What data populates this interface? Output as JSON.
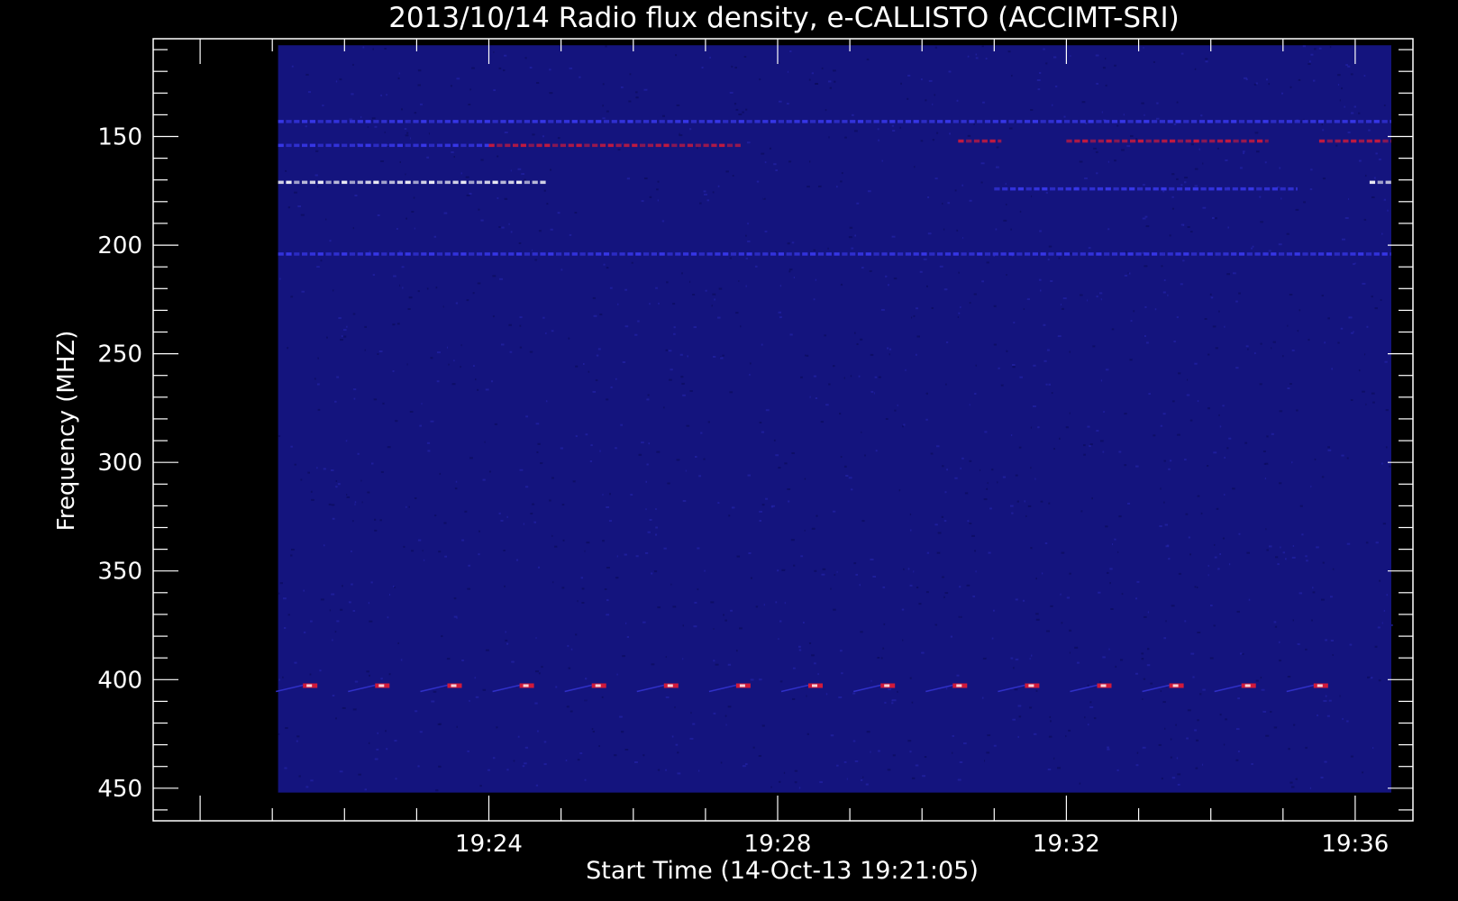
{
  "chart_data": {
    "type": "heatmap",
    "title": "2013/10/14  Radio flux density, e-CALLISTO (ACCIMT-SRI)",
    "xlabel": "Start Time (14-Oct-13 19:21:05)",
    "ylabel": "Frequency (MHZ)",
    "x_ticks": [
      "19:24",
      "19:28",
      "19:32",
      "19:36"
    ],
    "y_ticks": [
      "150",
      "200",
      "250",
      "300",
      "350",
      "400",
      "450"
    ],
    "x_range_minutes": [
      19.35,
      36.8
    ],
    "y_range_mhz": [
      105,
      465
    ],
    "data_range_minutes": [
      21.08,
      36.5
    ],
    "data_range_mhz": [
      108,
      452
    ],
    "colors": {
      "background": "#000000",
      "base": "#14147e",
      "bright": "#3a3af2",
      "hot": "#d21a3a",
      "peak": "#ffffff"
    },
    "features": [
      {
        "kind": "band",
        "mhz": 154,
        "t_start": 21.08,
        "t_end": 24.0,
        "intensity": "bright"
      },
      {
        "kind": "band",
        "mhz": 154,
        "t_start": 24.0,
        "t_end": 27.5,
        "intensity": "hot"
      },
      {
        "kind": "band",
        "mhz": 152,
        "t_start": 30.5,
        "t_end": 31.1,
        "intensity": "hot"
      },
      {
        "kind": "band",
        "mhz": 152,
        "t_start": 32.0,
        "t_end": 34.8,
        "intensity": "hot"
      },
      {
        "kind": "band",
        "mhz": 152,
        "t_start": 35.5,
        "t_end": 36.5,
        "intensity": "hot"
      },
      {
        "kind": "band",
        "mhz": 171,
        "t_start": 21.08,
        "t_end": 24.8,
        "intensity": "peak"
      },
      {
        "kind": "band",
        "mhz": 174,
        "t_start": 31.0,
        "t_end": 35.2,
        "intensity": "bright"
      },
      {
        "kind": "band",
        "mhz": 171,
        "t_start": 36.2,
        "t_end": 36.5,
        "intensity": "peak"
      },
      {
        "kind": "band",
        "mhz": 143,
        "t_start": 21.08,
        "t_end": 36.5,
        "intensity": "bright"
      },
      {
        "kind": "band",
        "mhz": 204,
        "t_start": 21.08,
        "t_end": 36.5,
        "intensity": "bright"
      },
      {
        "kind": "periodic_burst",
        "mhz": 403,
        "t_start": 21.4,
        "period_minutes": 1.0,
        "count": 15,
        "intensity": "hot"
      }
    ]
  }
}
